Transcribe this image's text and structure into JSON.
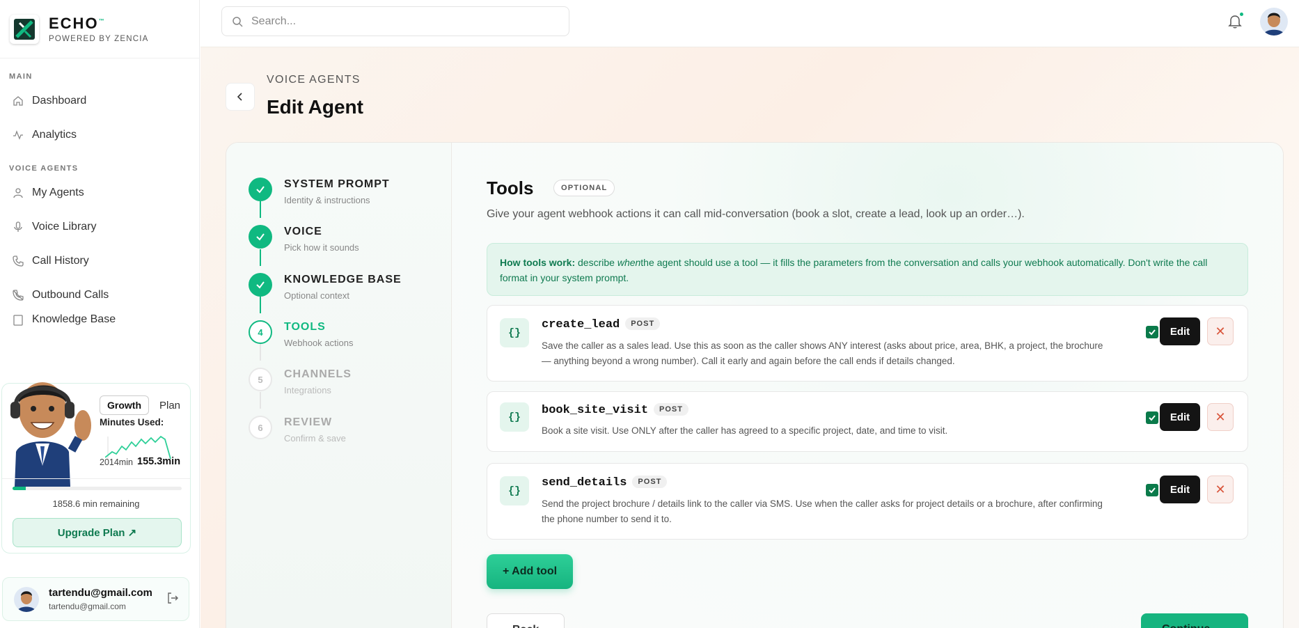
{
  "brand": {
    "name": "ECHO",
    "tm": "™",
    "sub": "POWERED BY ZENCIA"
  },
  "sidebar": {
    "sections": [
      {
        "title": "MAIN",
        "items": [
          {
            "label": "Dashboard",
            "icon": "home-icon"
          },
          {
            "label": "Analytics",
            "icon": "activity-icon"
          }
        ]
      },
      {
        "title": "VOICE AGENTS",
        "items": [
          {
            "label": "My Agents",
            "icon": "user-icon"
          },
          {
            "label": "Voice Library",
            "icon": "mic-icon"
          },
          {
            "label": "Call History",
            "icon": "phone-icon"
          },
          {
            "label": "Outbound Calls",
            "icon": "phone-outgoing-icon"
          },
          {
            "label": "Knowledge Base",
            "icon": "book-icon"
          }
        ]
      }
    ]
  },
  "plan": {
    "name": "Growth",
    "suffix": "Plan",
    "minutes_label": "Minutes Used:",
    "total": "2014min",
    "used": "155.3min",
    "remaining": "1858.6 min remaining",
    "progress_fraction": 0.077,
    "upgrade_label": "Upgrade Plan ↗"
  },
  "user": {
    "name": "tartendu@gmail.com",
    "email": "tartendu@gmail.com"
  },
  "search": {
    "placeholder": "Search..."
  },
  "header": {
    "breadcrumb": "VOICE AGENTS",
    "title": "Edit Agent"
  },
  "steps": [
    {
      "num": "1",
      "title": "SYSTEM PROMPT",
      "sub": "Identity & instructions",
      "state": "done"
    },
    {
      "num": "2",
      "title": "VOICE",
      "sub": "Pick how it sounds",
      "state": "done"
    },
    {
      "num": "3",
      "title": "KNOWLEDGE BASE",
      "sub": "Optional context",
      "state": "done"
    },
    {
      "num": "4",
      "title": "TOOLS",
      "sub": "Webhook actions",
      "state": "current"
    },
    {
      "num": "5",
      "title": "CHANNELS",
      "sub": "Integrations",
      "state": "todo"
    },
    {
      "num": "6",
      "title": "REVIEW",
      "sub": "Confirm & save",
      "state": "todo"
    }
  ],
  "tools_section": {
    "title": "Tools",
    "badge": "OPTIONAL",
    "description": "Give your agent webhook actions it can call mid-conversation (book a slot, create a lead, look up an order…).",
    "info_bold": "How tools work:",
    "info_pre": " describe ",
    "info_em": "when",
    "info_post": "the agent should use a tool — it fills the parameters from the conversation and calls your webhook automatically. Don't write the call format in your system prompt.",
    "tools": [
      {
        "icon": "{}",
        "name": "create_lead",
        "method": "POST",
        "enabled": true,
        "description": "Save the caller as a sales lead. Use this as soon as the caller shows ANY interest (asks about price, area, BHK, a project, the brochure — anything beyond a wrong number). Call it early and again before the call ends if details changed."
      },
      {
        "icon": "{}",
        "name": "book_site_visit",
        "method": "POST",
        "enabled": true,
        "description": "Book a site visit. Use ONLY after the caller has agreed to a specific project, date, and time to visit."
      },
      {
        "icon": "{}",
        "name": "send_details",
        "method": "POST",
        "enabled": true,
        "description": "Send the project brochure / details link to the caller via SMS. Use when the caller asks for project details or a brochure, after confirming the phone number to send it to."
      }
    ],
    "edit_label": "Edit",
    "delete_symbol": "✕",
    "add_label": "+ Add tool",
    "back_label": "Back",
    "continue_label": "Continue"
  },
  "colors": {
    "accent": "#10b981",
    "accent_dark": "#0f7a50",
    "danger": "#d9553b"
  }
}
